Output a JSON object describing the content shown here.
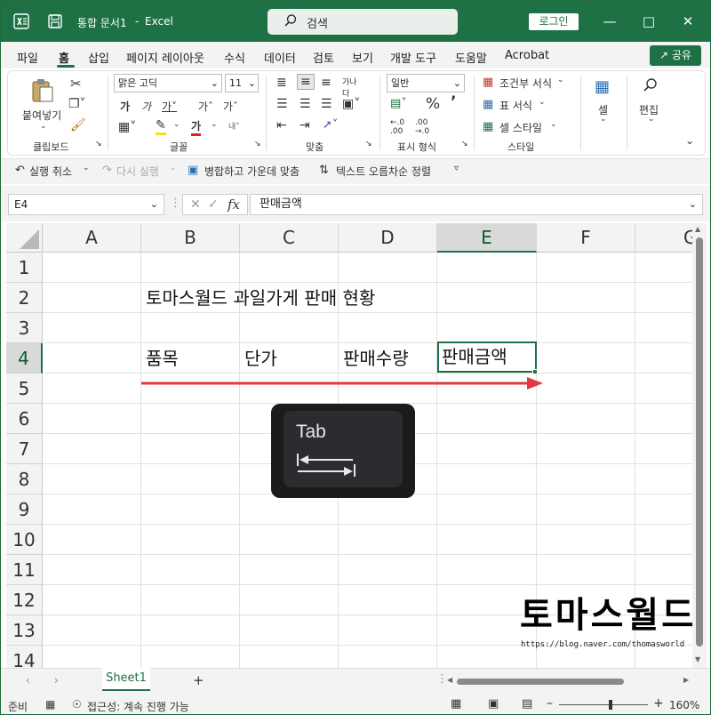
{
  "titlebar": {
    "doc_title": "통합 문서1",
    "separator": "-",
    "app_name": "Excel",
    "search_placeholder": "검색",
    "login_label": "로그인"
  },
  "menu": {
    "items": [
      "파일",
      "홈",
      "삽입",
      "페이지 레이아웃",
      "수식",
      "데이터",
      "검토",
      "보기",
      "개발 도구",
      "도움말",
      "Acrobat"
    ],
    "active": "홈",
    "share_label": "공유"
  },
  "ribbon": {
    "clipboard": {
      "paste_label": "붙여넣기",
      "group_label": "클립보드"
    },
    "font": {
      "font_name": "맑은 고딕",
      "font_size": "11",
      "group_label": "글꼴"
    },
    "alignment": {
      "group_label": "맞춤"
    },
    "number": {
      "format": "일반",
      "group_label": "표시 형식"
    },
    "styles": {
      "conditional": "조건부 서식",
      "table": "표 서식",
      "cell_style": "셀 스타일",
      "group_label": "스타일"
    },
    "cells": {
      "label": "셀"
    },
    "editing": {
      "label": "편집"
    }
  },
  "quickbar": {
    "undo": "실행 취소",
    "redo": "다시 실행",
    "merge": "병합하고 가운데 맞춤",
    "sort": "텍스트 오름차순 정렬"
  },
  "formula_bar": {
    "name_box": "E4",
    "fx": "fx",
    "content": "판매금액"
  },
  "sheet": {
    "columns": [
      "A",
      "B",
      "C",
      "D",
      "E",
      "F",
      "G"
    ],
    "selected_column": "E",
    "rows": [
      "1",
      "2",
      "3",
      "4",
      "5",
      "6",
      "7",
      "8",
      "9",
      "10",
      "11",
      "12",
      "13",
      "14"
    ],
    "selected_row": "4",
    "cells": {
      "B2": "토마스월드 과일가게 판매 현황",
      "B4": "품목",
      "C4": "단가",
      "D4": "판매수량",
      "E4": "판매금액"
    }
  },
  "overlay": {
    "key_label": "Tab",
    "brand": "토마스월드",
    "brand_url": "https://blog.naver.com/thomasworld"
  },
  "tabs": {
    "sheet_name": "Sheet1",
    "add_label": "+"
  },
  "status": {
    "ready": "준비",
    "accessibility": "접근성: 계속 진행 가능",
    "zoom": "160%"
  },
  "colors": {
    "excel_green": "#1e7145",
    "arrow_red": "#e0393e"
  }
}
